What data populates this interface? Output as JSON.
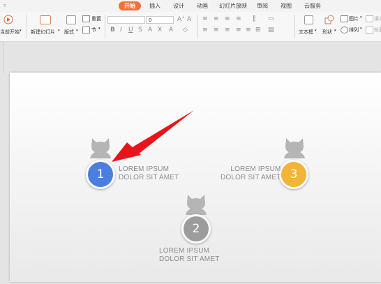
{
  "tabs": [
    "开始",
    "插入",
    "设计",
    "动画",
    "幻灯片放映",
    "审阅",
    "视图",
    "云服务"
  ],
  "active_tab": "开始",
  "ribbon": {
    "play_label": "当前开始",
    "new_slide_label": "新建幻灯片",
    "layout_label": "版式",
    "reset_label": "重置",
    "section_label": "节",
    "font_size_value": "0",
    "textbox_label": "文本框",
    "shape_label": "形状",
    "picture_label": "图片",
    "arrange_label": "排列",
    "fill_label": "填充",
    "outline_label": "轮廓"
  },
  "slide": {
    "items": [
      {
        "number": "1",
        "line1": "LOREM IPSUM",
        "line2": "DOLOR SIT AMET",
        "color": "#4a7fe0"
      },
      {
        "number": "2",
        "line1": "LOREM IPSUM",
        "line2": "DOLOR SIT AMET",
        "color": "#9c9c9c"
      },
      {
        "number": "3",
        "line1": "LOREM IPSUM",
        "line2": "DOLOR SIT AMET",
        "color": "#f3b43a"
      }
    ]
  },
  "colors": {
    "accent_tab": "#f0713a",
    "arrow": "#e8131b",
    "cat_silhouette": "#b5b5b5"
  },
  "icons": [
    "play-icon",
    "new-slide-icon",
    "layout-icon",
    "reset-icon",
    "section-icon",
    "textbox-icon",
    "shape-icon",
    "picture-icon",
    "arrange-icon",
    "fill-icon",
    "outline-icon",
    "cat-silhouette-icon"
  ]
}
